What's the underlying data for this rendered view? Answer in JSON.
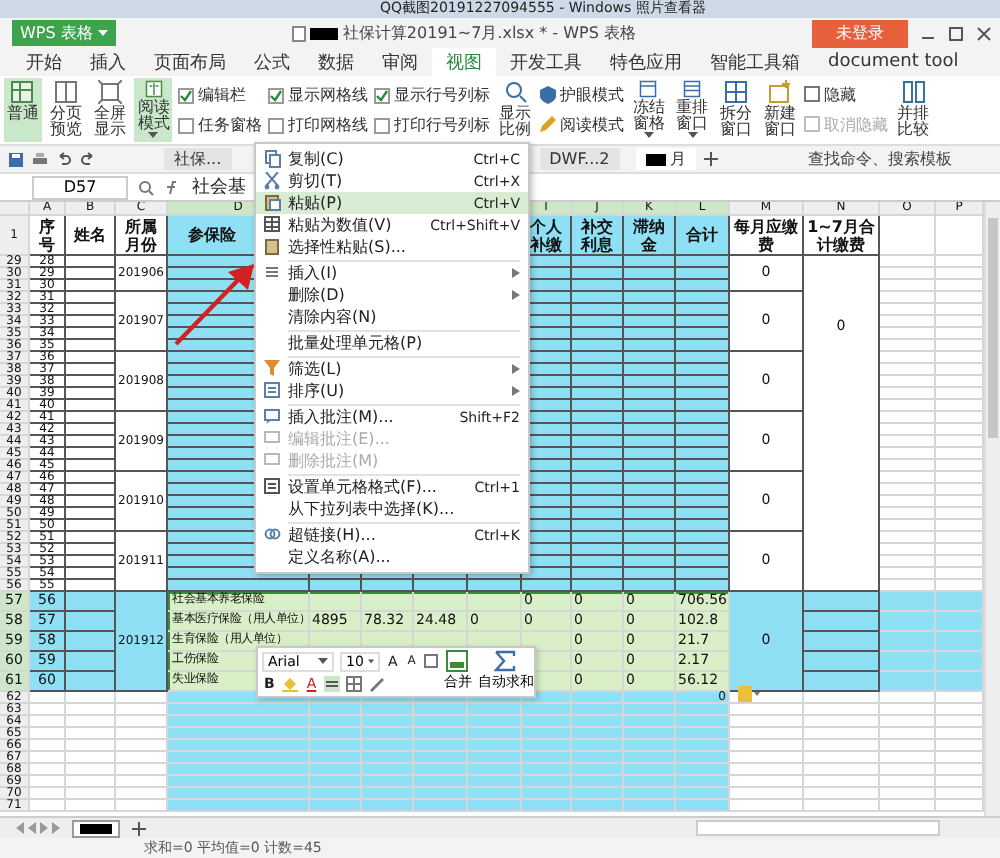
{
  "taskbar": {
    "title": "QQ截图20191227094555 - Windows 照片查看器"
  },
  "app": {
    "brand": "WPS 表格",
    "title": "社保计算20191~7月.xlsx * - WPS 表格",
    "login": "未登录"
  },
  "menu_tabs": [
    {
      "label": "开始",
      "selected": false
    },
    {
      "label": "插入",
      "selected": false
    },
    {
      "label": "页面布局",
      "selected": false
    },
    {
      "label": "公式",
      "selected": false
    },
    {
      "label": "数据",
      "selected": false
    },
    {
      "label": "审阅",
      "selected": false
    },
    {
      "label": "视图",
      "selected": true
    },
    {
      "label": "开发工具",
      "selected": false
    },
    {
      "label": "特色应用",
      "selected": false
    },
    {
      "label": "智能工具箱",
      "selected": false
    },
    {
      "label": "document tool",
      "selected": false
    }
  ],
  "ribbon": [
    {
      "kind": "large",
      "label": "普通",
      "selected": true,
      "dropdown": false
    },
    {
      "kind": "large",
      "label": "分页预览",
      "selected": false,
      "dropdown": false
    },
    {
      "kind": "large",
      "label": "全屏显示",
      "selected": false,
      "dropdown": false
    },
    {
      "kind": "large",
      "label": "阅读模式",
      "selected": true,
      "dropdown": true
    },
    {
      "kind": "checks",
      "items": [
        {
          "label": "编辑栏",
          "checked": true
        },
        {
          "label": "任务窗格",
          "checked": false
        }
      ]
    },
    {
      "kind": "checks",
      "items": [
        {
          "label": "显示网格线",
          "checked": true
        },
        {
          "label": "打印网格线",
          "checked": false
        }
      ]
    },
    {
      "kind": "checks",
      "items": [
        {
          "label": "显示行号列标",
          "checked": true
        },
        {
          "label": "打印行号列标",
          "checked": false
        }
      ]
    },
    {
      "kind": "large",
      "label": "显示比例",
      "selected": false,
      "dropdown": false
    },
    {
      "kind": "small",
      "items": [
        {
          "label": "护眼模式",
          "disabled": false
        },
        {
          "label": "阅读模式",
          "disabled": false
        }
      ]
    },
    {
      "kind": "large",
      "label": "冻结窗格",
      "selected": false,
      "dropdown": true
    },
    {
      "kind": "large",
      "label": "重排窗口",
      "selected": false,
      "dropdown": true
    },
    {
      "kind": "large",
      "label": "拆分窗口",
      "selected": false,
      "dropdown": false
    },
    {
      "kind": "large",
      "label": "新建窗口",
      "selected": false,
      "dropdown": false
    },
    {
      "kind": "small",
      "items": [
        {
          "label": "隐藏",
          "disabled": false
        },
        {
          "label": "取消隐藏",
          "disabled": true
        }
      ]
    },
    {
      "kind": "large",
      "label": "并排比较",
      "selected": false,
      "dropdown": false
    }
  ],
  "quick_bar": {
    "doc_tabs": [
      {
        "label": "社保...",
        "selected": false
      },
      {
        "label": "DWF...2",
        "selected": false
      },
      {
        "label": "月",
        "selected": true
      }
    ],
    "search": {
      "placeholder": "查找命令、搜索模板"
    }
  },
  "formula_bar": {
    "name_box": "D57",
    "content": "社会基"
  },
  "sheet": {
    "columns_left": [
      {
        "letter": "A",
        "header": "序号"
      },
      {
        "letter": "B",
        "header": "姓名"
      },
      {
        "letter": "C",
        "header": "所属月份"
      },
      {
        "letter": "D",
        "header": "参保险"
      }
    ],
    "columns_right": [
      {
        "letter": "I",
        "header": "个人补缴"
      },
      {
        "letter": "J",
        "header": "补交利息"
      },
      {
        "letter": "K",
        "header": "滞纳金"
      },
      {
        "letter": "L",
        "header": "合计"
      },
      {
        "letter": "M",
        "header": "每月应缴费"
      },
      {
        "letter": "N",
        "header": "1~7月合计缴费"
      },
      {
        "letter": "O"
      },
      {
        "letter": "P"
      }
    ],
    "header_row": "1",
    "total_fee": "0",
    "groups": [
      {
        "month": "201906",
        "fee": "0",
        "highlighted": false,
        "rows": [
          {
            "row": "29",
            "seq": "28"
          },
          {
            "row": "30",
            "seq": "29"
          },
          {
            "row": "31",
            "seq": "30"
          }
        ]
      },
      {
        "month": "201907",
        "fee": "0",
        "highlighted": false,
        "rows": [
          {
            "row": "32",
            "seq": "31"
          },
          {
            "row": "33",
            "seq": "32"
          },
          {
            "row": "34",
            "seq": "33"
          },
          {
            "row": "35",
            "seq": "34"
          },
          {
            "row": "36",
            "seq": "35"
          }
        ]
      },
      {
        "month": "201908",
        "fee": "0",
        "highlighted": false,
        "rows": [
          {
            "row": "37",
            "seq": "36"
          },
          {
            "row": "38",
            "seq": "37"
          },
          {
            "row": "39",
            "seq": "38"
          },
          {
            "row": "40",
            "seq": "39"
          },
          {
            "row": "41",
            "seq": "40"
          }
        ]
      },
      {
        "month": "201909",
        "fee": "0",
        "highlighted": false,
        "rows": [
          {
            "row": "42",
            "seq": "41"
          },
          {
            "row": "43",
            "seq": "42"
          },
          {
            "row": "44",
            "seq": "43"
          },
          {
            "row": "45",
            "seq": "44"
          },
          {
            "row": "46",
            "seq": "45"
          }
        ]
      },
      {
        "month": "201910",
        "fee": "0",
        "highlighted": false,
        "rows": [
          {
            "row": "47",
            "seq": "46"
          },
          {
            "row": "48",
            "seq": "47"
          },
          {
            "row": "49",
            "seq": "48"
          },
          {
            "row": "50",
            "seq": "49"
          },
          {
            "row": "51",
            "seq": "50"
          }
        ]
      },
      {
        "month": "201911",
        "fee": "0",
        "highlighted": false,
        "rows": [
          {
            "row": "52",
            "seq": "51"
          },
          {
            "row": "53",
            "seq": "52"
          },
          {
            "row": "54",
            "seq": "53"
          },
          {
            "row": "55",
            "seq": "54"
          },
          {
            "row": "56",
            "seq": "55"
          }
        ]
      },
      {
        "month": "201912",
        "fee": "0",
        "highlighted": true,
        "rows": [
          {
            "row": "57",
            "seq": "56",
            "cells": {
              "D": "社会基本养老保险",
              "I": "0",
              "J": "0",
              "K": "0",
              "L": "706.56"
            }
          },
          {
            "row": "58",
            "seq": "57",
            "cells": {
              "D": "基本医疗保险（用人单位）",
              "E": "4895",
              "F": "78.32",
              "G": "24.48",
              "H": "0",
              "I": "0",
              "J": "0",
              "K": "0",
              "L": "102.8"
            }
          },
          {
            "row": "59",
            "seq": "58",
            "cells": {
              "D": "生育保险（用人单位）",
              "J": "0",
              "K": "0",
              "L": "21.7"
            }
          },
          {
            "row": "60",
            "seq": "59",
            "cells": {
              "D": "工伤保险",
              "J": "0",
              "K": "0",
              "L": "2.17"
            }
          },
          {
            "row": "61",
            "seq": "60",
            "cells": {
              "D": "失业保险",
              "J": "0",
              "K": "0",
              "L": "56.12"
            }
          }
        ]
      }
    ],
    "empty_rows": [
      "62",
      "63",
      "64",
      "65",
      "66",
      "67",
      "68",
      "69",
      "70",
      "71"
    ],
    "stray_value": "0"
  },
  "context_menu": {
    "items": [
      {
        "kind": "item",
        "label": "复制(C)",
        "shortcut": "Ctrl+C",
        "selected": false,
        "disabled": false,
        "submenu": false
      },
      {
        "kind": "item",
        "label": "剪切(T)",
        "shortcut": "Ctrl+X",
        "selected": false,
        "disabled": false,
        "submenu": false
      },
      {
        "kind": "item",
        "label": "粘贴(P)",
        "shortcut": "Ctrl+V",
        "selected": true,
        "disabled": false,
        "submenu": false
      },
      {
        "kind": "item",
        "label": "粘贴为数值(V)",
        "shortcut": "Ctrl+Shift+V",
        "selected": false,
        "disabled": false,
        "submenu": false
      },
      {
        "kind": "item",
        "label": "选择性粘贴(S)...",
        "selected": false,
        "disabled": false,
        "submenu": false
      },
      {
        "kind": "separator"
      },
      {
        "kind": "item",
        "label": "插入(I)",
        "selected": false,
        "disabled": false,
        "submenu": true
      },
      {
        "kind": "item",
        "label": "删除(D)",
        "selected": false,
        "disabled": false,
        "submenu": true
      },
      {
        "kind": "item",
        "label": "清除内容(N)",
        "selected": false,
        "disabled": false,
        "submenu": false
      },
      {
        "kind": "separator"
      },
      {
        "kind": "item",
        "label": "批量处理单元格(P)",
        "selected": false,
        "disabled": false,
        "submenu": false
      },
      {
        "kind": "separator"
      },
      {
        "kind": "item",
        "label": "筛选(L)",
        "selected": false,
        "disabled": false,
        "submenu": true
      },
      {
        "kind": "item",
        "label": "排序(U)",
        "selected": false,
        "disabled": false,
        "submenu": true
      },
      {
        "kind": "separator"
      },
      {
        "kind": "item",
        "label": "插入批注(M)...",
        "shortcut": "Shift+F2",
        "selected": false,
        "disabled": false,
        "submenu": false
      },
      {
        "kind": "item",
        "label": "编辑批注(E)...",
        "selected": false,
        "disabled": true,
        "submenu": false
      },
      {
        "kind": "item",
        "label": "删除批注(M)",
        "selected": false,
        "disabled": true,
        "submenu": false
      },
      {
        "kind": "separator"
      },
      {
        "kind": "item",
        "label": "设置单元格格式(F)...",
        "shortcut": "Ctrl+1",
        "selected": false,
        "disabled": false,
        "submenu": false
      },
      {
        "kind": "item",
        "label": "从下拉列表中选择(K)...",
        "selected": false,
        "disabled": false,
        "submenu": false
      },
      {
        "kind": "separator"
      },
      {
        "kind": "item",
        "label": "超链接(H)...",
        "shortcut": "Ctrl+K",
        "selected": false,
        "disabled": false,
        "submenu": false
      },
      {
        "kind": "item",
        "label": "定义名称(A)...",
        "selected": false,
        "disabled": false,
        "submenu": false
      }
    ]
  },
  "mini_toolbar": {
    "font": "Arial",
    "size": "10",
    "grow_font": "A",
    "shrink_font": "A",
    "bold": "B",
    "font_color": "A",
    "merge": "合并",
    "autosum": "自动求和"
  },
  "status_bar": {
    "text": "求和=0 平均值=0 计数=45"
  }
}
